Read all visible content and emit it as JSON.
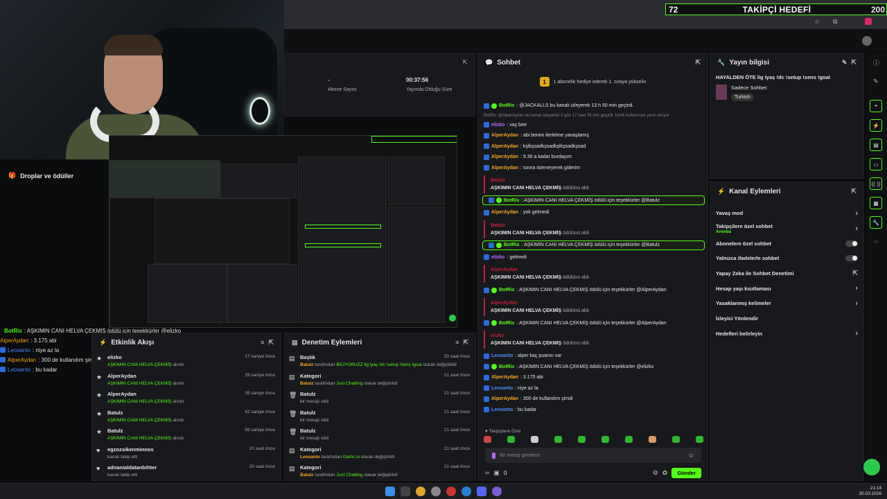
{
  "goal": {
    "current": "72",
    "title": "TAKİPÇİ HEDEFİ",
    "target": "200"
  },
  "stats": [
    {
      "value": "-",
      "label": "Abone Sayısı"
    },
    {
      "value": "00:37:56",
      "label": "Yayında Olduğu Süre"
    }
  ],
  "sidebar_item": "Droplar ve ödüller",
  "overlay_chat": [
    {
      "user": "BotRix",
      "color": "#53fc18",
      "text": ": AŞKIMIN CANI HELVA ÇEKMİŞ ödülü için teşekkürler @elizko"
    },
    {
      "user": "AlperAydan",
      "color": "#f5a623",
      "text": ": 3.175 abi"
    },
    {
      "user": "Leosanto",
      "color": "#4c8dff",
      "text": ": niye az la"
    },
    {
      "user": "AlperAydan",
      "color": "#f5a623",
      "text": ": 300 de kullandım şimdi"
    },
    {
      "user": "Leosanto",
      "color": "#4c8dff",
      "text": ": bu kadar"
    }
  ],
  "activity": {
    "title": "Etkinlik Akışı",
    "rows": [
      {
        "icon": "star",
        "user": "elizko",
        "sub": "AŞKIMIN CANI HELVA ÇEKMİŞ",
        "tail": "alındı",
        "time": "17 saniye önce"
      },
      {
        "icon": "star",
        "user": "AlperAydan",
        "sub": "AŞKIMIN CANI HELVA ÇEKMİŞ",
        "tail": "alındı",
        "time": "29 saniye önce"
      },
      {
        "icon": "star",
        "user": "AlperAydan",
        "sub": "AŞKIMIN CANI HELVA ÇEKMİŞ",
        "tail": "alındı",
        "time": "39 saniye önce"
      },
      {
        "icon": "star",
        "user": "Batulz",
        "sub": "AŞKIMIN CANI HELVA ÇEKMİŞ",
        "tail": "alındı",
        "time": "42 saniye önce"
      },
      {
        "icon": "star",
        "user": "Batulz",
        "sub": "AŞKIMIN CANI HELVA ÇEKMİŞ",
        "tail": "alındı",
        "time": "59 saniye önce"
      },
      {
        "icon": "heart",
        "user": "egzozsikenminnos",
        "sub": "",
        "tail": "kanalı takip etti",
        "time": "20 saat önce"
      },
      {
        "icon": "heart",
        "user": "adnanialdatanbihter",
        "sub": "",
        "tail": "kanalı takip etti",
        "time": "20 saat önce"
      }
    ]
  },
  "modlog": {
    "title": "Denetim Eylemleri",
    "rows": [
      {
        "icon": "doc",
        "title": "Başlık",
        "who": "Batulz",
        "mid": " tarafından ",
        "what": "BİLİYORUZZ lig lyaş !dc !setup !sens !goal",
        "tail": " olarak değiştirildi",
        "time": "20 saat önce"
      },
      {
        "icon": "doc",
        "title": "Kategori",
        "who": "Batulz",
        "mid": " tarafından ",
        "what": "Just Chatting",
        "tail": " olarak değiştirildi",
        "time": "21 saat önce"
      },
      {
        "icon": "trash",
        "title": "Batulz",
        "who": "",
        "mid": "",
        "what": "",
        "tail": "bir mesajı sildi",
        "time": "21 saat önce"
      },
      {
        "icon": "trash",
        "title": "Batulz",
        "who": "",
        "mid": "",
        "what": "",
        "tail": "bir mesajı sildi",
        "time": "21 saat önce"
      },
      {
        "icon": "trash",
        "title": "Batulz",
        "who": "",
        "mid": "",
        "what": "",
        "tail": "bir mesajı sildi",
        "time": "21 saat önce"
      },
      {
        "icon": "doc",
        "title": "Kategori",
        "who": "Leosanto",
        "mid": " tarafından ",
        "what": "Gartic.io",
        "tail": " olarak değiştirildi",
        "time": "21 saat önce"
      },
      {
        "icon": "doc",
        "title": "Kategori",
        "who": "Batulz",
        "mid": " tarafından ",
        "what": "Just Chatting",
        "tail": " olarak değiştirildi",
        "time": "21 saat önce"
      }
    ]
  },
  "chat": {
    "title": "Sohbet",
    "pinned": "1 abonelik hediye ederek 1. sıraya yükselin",
    "messages": [
      {
        "kind": "msg",
        "user": "BotRix",
        "color": "#53fc18",
        "text": ": @JACKALLS bu kanalı izleyerek 13 h 50 min geçirdi."
      },
      {
        "kind": "reply",
        "text": "BotRix: @AlperAydan bu kanalı izleyerek 3 gün 17 saat 55 min geçirdi. İsimli kullanıcıya yanıt veriyor"
      },
      {
        "kind": "msg",
        "user": "elizko",
        "color": "#b36bff",
        "text": ": vay bee"
      },
      {
        "kind": "msg",
        "user": "AlperAydan",
        "color": "#f5a623",
        "text": ": abi benim ilerlelme yavaşlamış"
      },
      {
        "kind": "msg",
        "user": "AlperAydan",
        "color": "#f5a623",
        "text": ": kşlkşsadkşsadkşlkşsadkşsad"
      },
      {
        "kind": "msg",
        "user": "AlperAydan",
        "color": "#f5a623",
        "text": ": 9.30 a kadar burdayım"
      },
      {
        "kind": "msg",
        "user": "AlperAydan",
        "color": "#f5a623",
        "text": ": sonra istemeyerek giderim"
      },
      {
        "kind": "redeem",
        "user": "Batulz",
        "reward": "AŞKIMIN CANI HELVA ÇEKMİŞ",
        "tail": " ödülünü aldı"
      },
      {
        "kind": "hl",
        "user": "BotRix",
        "color": "#53fc18",
        "text": ": AŞKIMIN CANI HELVA ÇEKMİŞ ödülü için teşekkürler @Batulz"
      },
      {
        "kind": "msg",
        "user": "AlperAydan",
        "color": "#f5a623",
        "text": ": yok gelmedi"
      },
      {
        "kind": "redeem",
        "user": "Batulz",
        "reward": "AŞKIMIN CANI HELVA ÇEKMİŞ",
        "tail": " ödülünü aldı"
      },
      {
        "kind": "hl",
        "user": "BotRix",
        "color": "#53fc18",
        "text": ": AŞKIMIN CANI HELVA ÇEKMİŞ ödülü için teşekkürler @Batulz"
      },
      {
        "kind": "msg",
        "user": "elizko",
        "color": "#b36bff",
        "text": ": gelmedi"
      },
      {
        "kind": "redeem",
        "user": "AlperAydan",
        "reward": "AŞKIMIN CANI HELVA ÇEKMİŞ",
        "tail": " ödülünü aldı"
      },
      {
        "kind": "msg",
        "user": "BotRix",
        "color": "#53fc18",
        "text": ": AŞKIMIN CANI HELVA ÇEKMİŞ ödülü için teşekkürler @AlperAydan"
      },
      {
        "kind": "redeem",
        "user": "AlperAydan",
        "reward": "AŞKIMIN CANI HELVA ÇEKMİŞ",
        "tail": " ödülünü aldı"
      },
      {
        "kind": "msg",
        "user": "BotRix",
        "color": "#53fc18",
        "text": ": AŞKIMIN CANI HELVA ÇEKMİŞ ödülü için teşekkürler @AlperAydan"
      },
      {
        "kind": "redeem",
        "user": "elizko",
        "reward": "AŞKIMIN CANI HELVA ÇEKMİŞ",
        "tail": " ödülünü aldı"
      },
      {
        "kind": "msg",
        "user": "Leosanto",
        "color": "#4c8dff",
        "text": ": alper kaç puanın var"
      },
      {
        "kind": "msg",
        "user": "BotRix",
        "color": "#53fc18",
        "text": ": AŞKIMIN CANI HELVA ÇEKMİŞ ödülü için teşekkürler @elizko"
      },
      {
        "kind": "msg",
        "user": "AlperAydan",
        "color": "#f5a623",
        "text": ": 3.175 abi"
      },
      {
        "kind": "msg",
        "user": "Leosanto",
        "color": "#4c8dff",
        "text": ": niye az la"
      },
      {
        "kind": "msg",
        "user": "AlperAydan",
        "color": "#f5a623",
        "text": ": 300 de kullandım şimdi"
      },
      {
        "kind": "msg",
        "user": "Leosanto",
        "color": "#4c8dff",
        "text": ": bu kadar"
      }
    ],
    "followers_only": "Takipçilere Özel",
    "input_placeholder": "Bir mesaj gönderin",
    "points": "0",
    "send": "Gönder"
  },
  "stream_info": {
    "title": "Yayın bilgisi",
    "stream_title": "HAYALDEN ÖTE lig lyaş !dc !setup !sens !goal",
    "category": "Sadece Sohbet",
    "tag": "Turkish"
  },
  "channel_actions": {
    "title": "Kanal Eylemleri",
    "items": [
      {
        "label": "Yavaş mod",
        "sub": "",
        "ctrl": "chevron"
      },
      {
        "label": "Takipçilere özel sohbet",
        "sub": "Anında",
        "ctrl": "chevron"
      },
      {
        "label": "Abonelere özel sohbet",
        "sub": "",
        "ctrl": "toggle"
      },
      {
        "label": "Yalnızca ifadelerle sohbet",
        "sub": "",
        "ctrl": "toggle"
      },
      {
        "label": "Yapay Zeka ile Sohbet Denetimi",
        "sub": "",
        "ctrl": "ext"
      },
      {
        "label": "Hesap yaşı kısıtlaması",
        "sub": "",
        "ctrl": "chevron"
      },
      {
        "label": "Yasaklanmış kelimeler",
        "sub": "",
        "ctrl": "chevron"
      },
      {
        "label": "İzleyici Yönlendir",
        "sub": "",
        "ctrl": ""
      },
      {
        "label": "Hedefleri belirleyin",
        "sub": "",
        "ctrl": "chevron"
      }
    ]
  },
  "clock": {
    "time": "21:14",
    "date": "30.03.2026"
  },
  "colors": {
    "accent": "#53fc18",
    "redeem": "#c41f3b"
  }
}
